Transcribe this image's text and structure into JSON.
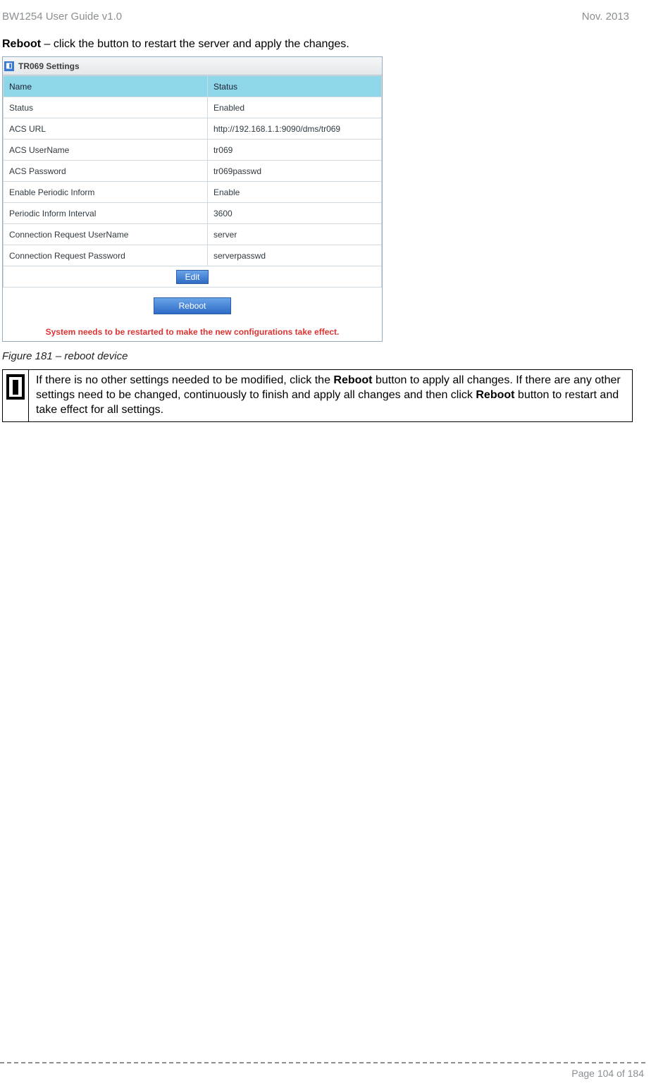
{
  "header": {
    "left": "BW1254 User Guide v1.0",
    "right": "Nov.  2013"
  },
  "reboot_line": {
    "bold": "Reboot",
    "rest": " – click the button to restart the server and apply the changes."
  },
  "panel": {
    "title": "TR069 Settings",
    "columns": {
      "name": "Name",
      "status": "Status"
    },
    "rows": [
      {
        "name": "Status",
        "value": "Enabled"
      },
      {
        "name": "ACS URL",
        "value": "http://192.168.1.1:9090/dms/tr069"
      },
      {
        "name": "ACS UserName",
        "value": "tr069"
      },
      {
        "name": "ACS Password",
        "value": "tr069passwd"
      },
      {
        "name": "Enable Periodic Inform",
        "value": "Enable"
      },
      {
        "name": "Periodic Inform Interval",
        "value": "3600"
      },
      {
        "name": "Connection Request UserName",
        "value": "server"
      },
      {
        "name": "Connection Request Password",
        "value": "serverpasswd"
      }
    ],
    "edit_label": "Edit",
    "reboot_label": "Reboot",
    "warn": "System needs to be restarted to make the new configurations take effect."
  },
  "caption": "Figure 181 – reboot device",
  "callout": {
    "t1": "If there is no other settings needed to be modified, click the ",
    "b1": "Reboot",
    "t2": " button to apply all changes. If there are any other settings need to be changed, continuously to finish and apply all changes and then click ",
    "b2": "Reboot",
    "t3": " button to restart and take effect  for all settings."
  },
  "footer": {
    "page": "Page 104 of 184"
  }
}
